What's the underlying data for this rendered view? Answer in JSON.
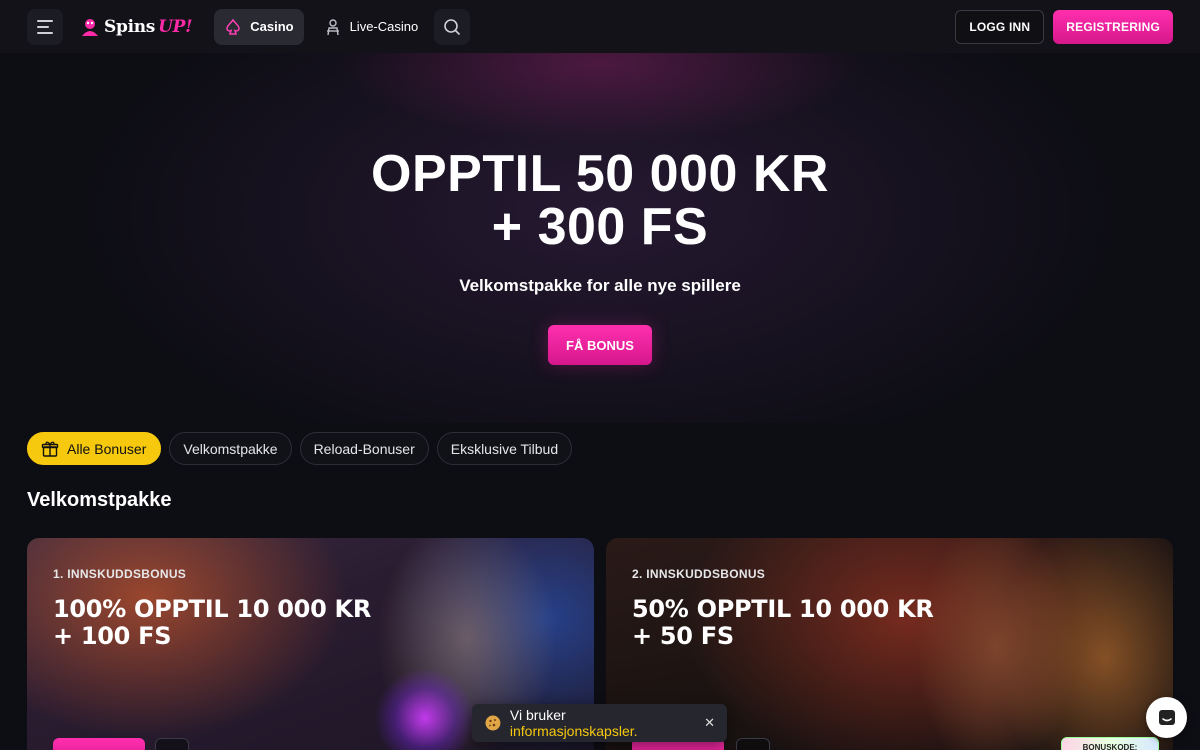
{
  "header": {
    "logo_text": "Spins",
    "logo_accent": "UP!",
    "nav": [
      {
        "label": "Casino",
        "icon": "spade-icon"
      },
      {
        "label": "Live-Casino",
        "icon": "dealer-icon"
      }
    ],
    "login_label": "LOGG INN",
    "register_label": "REGISTRERING"
  },
  "hero": {
    "title_line1": "OPPTIL 50 000 KR",
    "title_line2": "+ 300 FS",
    "subtitle": "Velkomstpakke for alle nye spillere",
    "cta_label": "FÅ BONUS"
  },
  "filters": [
    {
      "label": "Alle Bonuser",
      "active": true,
      "icon": "gift-icon"
    },
    {
      "label": "Velkomstpakke",
      "active": false
    },
    {
      "label": "Reload-Bonuser",
      "active": false
    },
    {
      "label": "Eksklusive Tilbud",
      "active": false
    }
  ],
  "section_title": "Velkomstpakke",
  "cards": [
    {
      "label": "1. INNSKUDDSBONUS",
      "title_line1": "100% OPPTIL 10 000 KR",
      "title_line2": "+ 100 FS"
    },
    {
      "label": "2. INNSKUDDSBONUS",
      "title_line1": "50% OPPTIL 10 000 KR",
      "title_line2": "+ 50 FS",
      "bonus_code_label": "BONUSKODE:"
    }
  ],
  "cookie": {
    "text": "Vi bruker",
    "link": "informasjonskapsler."
  },
  "colors": {
    "accent_pink": "#ff2fae",
    "active_chip": "#f6c90e",
    "background": "#0d0d14"
  }
}
